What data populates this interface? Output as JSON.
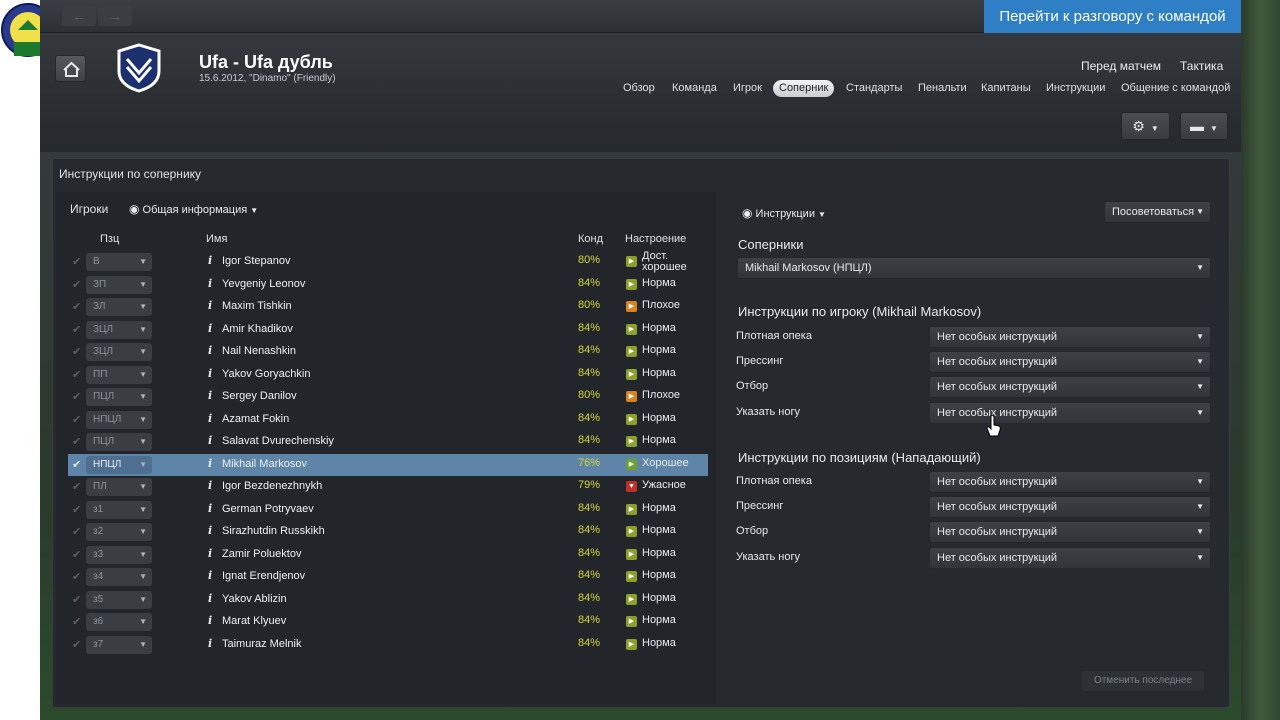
{
  "topbar": {
    "back_arrow": "←",
    "fwd_arrow": "→",
    "goto_team_talk": "Перейти к разговору с командой"
  },
  "match": {
    "title": "Ufa - Ufa дубль",
    "subtitle": "15.6.2012, \"Dinamo\" (Friendly)"
  },
  "top_links": [
    "Перед матчем",
    "Тактика"
  ],
  "tabs": [
    "Обзор",
    "Команда",
    "Игрок",
    "Соперник",
    "Стандарты",
    "Пенальти",
    "Капитаны",
    "Инструкции",
    "Общение с командой"
  ],
  "active_tab": "Соперник",
  "panel": {
    "title": "Инструкции по сопернику",
    "players_label": "Игроки",
    "view_select": "Общая информация",
    "columns": {
      "pos": "Пзц",
      "name": "Имя",
      "cond": "Конд",
      "mood": "Настроение"
    },
    "players": [
      {
        "pos": "В",
        "name": "Igor Stepanov",
        "cond": "80%",
        "mood": "Дост. хорошее",
        "mood_color": "#8ca02a"
      },
      {
        "pos": "ЗП",
        "name": "Yevgeniy Leonov",
        "cond": "84%",
        "mood": "Норма",
        "mood_color": "#8ca02a"
      },
      {
        "pos": "ЗЛ",
        "name": "Maxim Tishkin",
        "cond": "80%",
        "mood": "Плохое",
        "mood_color": "#d8841e"
      },
      {
        "pos": "ЗЦЛ",
        "name": "Amir Khadikov",
        "cond": "84%",
        "mood": "Норма",
        "mood_color": "#8ca02a"
      },
      {
        "pos": "ЗЦЛ",
        "name": "Nail Nenashkin",
        "cond": "84%",
        "mood": "Норма",
        "mood_color": "#8ca02a"
      },
      {
        "pos": "ПП",
        "name": "Yakov Goryachkin",
        "cond": "84%",
        "mood": "Норма",
        "mood_color": "#8ca02a"
      },
      {
        "pos": "ПЦЛ",
        "name": "Sergey Danilov",
        "cond": "80%",
        "mood": "Плохое",
        "mood_color": "#d8841e"
      },
      {
        "pos": "НПЦЛ",
        "name": "Azamat Fokin",
        "cond": "84%",
        "mood": "Норма",
        "mood_color": "#8ca02a"
      },
      {
        "pos": "ПЦЛ",
        "name": "Salavat Dvurechenskiy",
        "cond": "84%",
        "mood": "Норма",
        "mood_color": "#8ca02a"
      },
      {
        "pos": "НПЦЛ",
        "name": "Mikhail Markosov",
        "cond": "76%",
        "mood": "Хорошее",
        "mood_color": "#6aa22a",
        "selected": true
      },
      {
        "pos": "ПЛ",
        "name": "Igor Bezdenezhnykh",
        "cond": "79%",
        "mood": "Ужасное",
        "mood_color": "#c0302a"
      },
      {
        "pos": "з1",
        "name": "German Potryvaev",
        "cond": "84%",
        "mood": "Норма",
        "mood_color": "#8ca02a"
      },
      {
        "pos": "з2",
        "name": "Sirazhutdin Russkikh",
        "cond": "84%",
        "mood": "Норма",
        "mood_color": "#8ca02a"
      },
      {
        "pos": "з3",
        "name": "Zamir Poluektov",
        "cond": "84%",
        "mood": "Норма",
        "mood_color": "#8ca02a"
      },
      {
        "pos": "з4",
        "name": "Ignat Erendjenov",
        "cond": "84%",
        "mood": "Норма",
        "mood_color": "#8ca02a"
      },
      {
        "pos": "з5",
        "name": "Yakov Ablizin",
        "cond": "84%",
        "mood": "Норма",
        "mood_color": "#8ca02a"
      },
      {
        "pos": "з6",
        "name": "Marat Klyuev",
        "cond": "84%",
        "mood": "Норма",
        "mood_color": "#8ca02a"
      },
      {
        "pos": "з7",
        "name": "Taimuraz Melnik",
        "cond": "84%",
        "mood": "Норма",
        "mood_color": "#8ca02a"
      }
    ]
  },
  "right": {
    "view_select": "Инструкции",
    "advise_button": "Посоветоваться",
    "opponents_label": "Соперники",
    "opponent_selected": "Mikhail Markosov (НПЦЛ)",
    "player_instr_title": "Инструкции по игроку (Mikhail Markosov)",
    "position_instr_title": "Инструкции по позициям (Нападающий)",
    "instr_labels": [
      "Плотная опека",
      "Прессинг",
      "Отбор",
      "Указать ногу"
    ],
    "instr_value": "Нет особых инструкций",
    "undo_button": "Отменить последнее"
  },
  "colors": {
    "accent": "#2f7fc6",
    "selected_row": "#5e84a8",
    "condition": "#d6d636"
  }
}
